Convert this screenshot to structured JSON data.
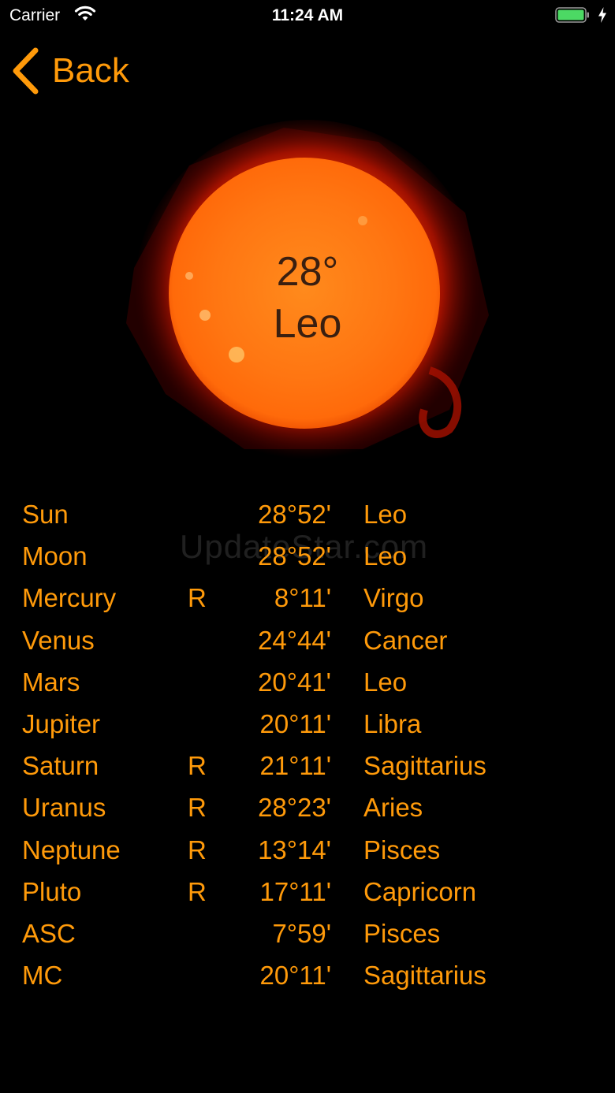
{
  "status_bar": {
    "carrier": "Carrier",
    "time": "11:24 AM",
    "battery_color": "#4cd964"
  },
  "nav": {
    "back_label": "Back"
  },
  "accent_color": "#ff9a0a",
  "sun": {
    "degree": "28°",
    "sign": "Leo"
  },
  "watermark": "UpdateStar.com",
  "planets": [
    {
      "name": "Sun",
      "retro": "",
      "degree": "28°52'",
      "sign": "Leo"
    },
    {
      "name": "Moon",
      "retro": "",
      "degree": "28°52'",
      "sign": "Leo"
    },
    {
      "name": "Mercury",
      "retro": "R",
      "degree": "8°11'",
      "sign": "Virgo"
    },
    {
      "name": "Venus",
      "retro": "",
      "degree": "24°44'",
      "sign": "Cancer"
    },
    {
      "name": "Mars",
      "retro": "",
      "degree": "20°41'",
      "sign": "Leo"
    },
    {
      "name": "Jupiter",
      "retro": "",
      "degree": "20°11'",
      "sign": "Libra"
    },
    {
      "name": "Saturn",
      "retro": "R",
      "degree": "21°11'",
      "sign": "Sagittarius"
    },
    {
      "name": "Uranus",
      "retro": "R",
      "degree": "28°23'",
      "sign": "Aries"
    },
    {
      "name": "Neptune",
      "retro": "R",
      "degree": "13°14'",
      "sign": "Pisces"
    },
    {
      "name": "Pluto",
      "retro": "R",
      "degree": "17°11'",
      "sign": "Capricorn"
    },
    {
      "name": "ASC",
      "retro": "",
      "degree": "7°59'",
      "sign": "Pisces"
    },
    {
      "name": "MC",
      "retro": "",
      "degree": "20°11'",
      "sign": "Sagittarius"
    }
  ]
}
